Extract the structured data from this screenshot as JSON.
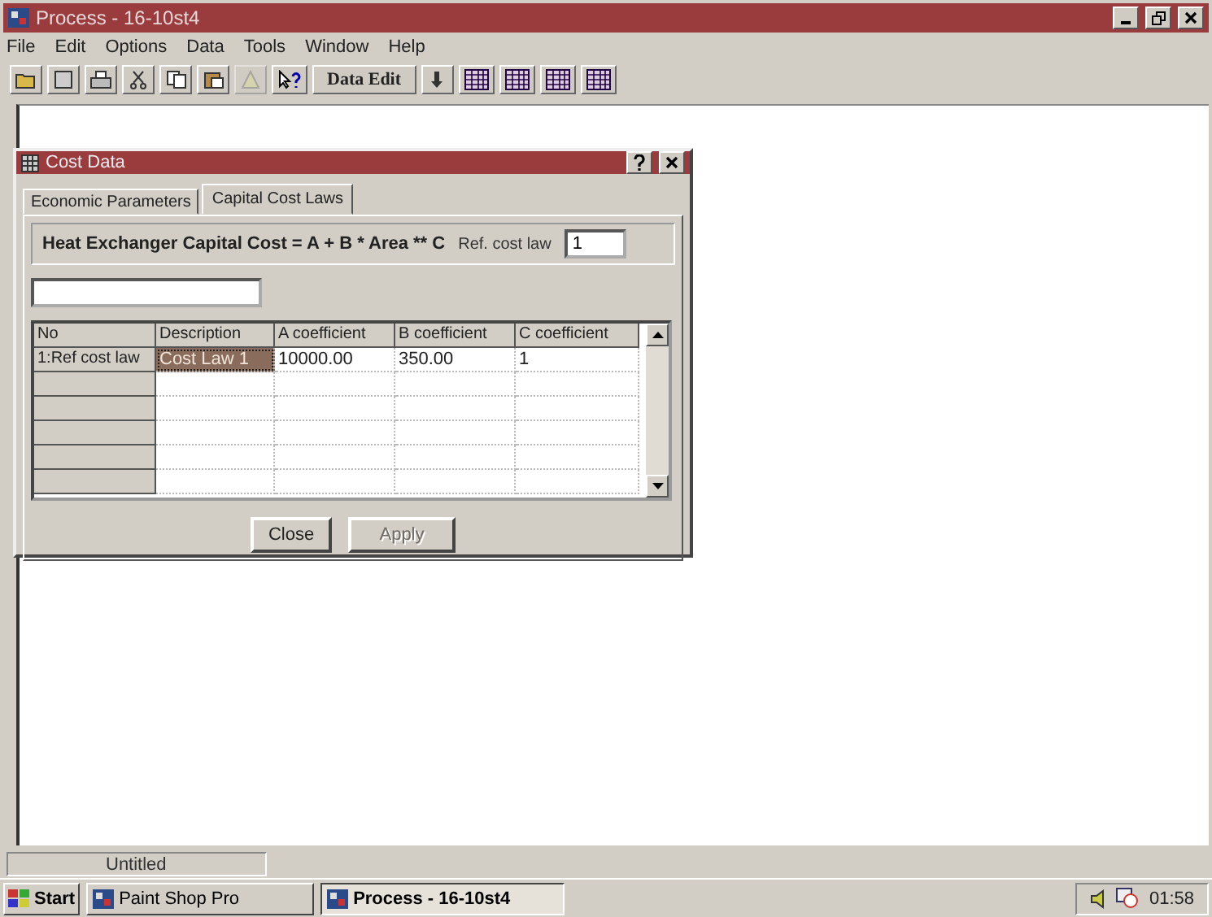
{
  "window": {
    "title": "Process - 16-10st4"
  },
  "menu": [
    "File",
    "Edit",
    "Options",
    "Data",
    "Tools",
    "Window",
    "Help"
  ],
  "toolbar": [
    {
      "kind": "open",
      "disabled": false
    },
    {
      "kind": "save",
      "disabled": false
    },
    {
      "kind": "print",
      "disabled": false
    },
    {
      "kind": "cut",
      "disabled": false
    },
    {
      "kind": "copy",
      "disabled": false
    },
    {
      "kind": "paste",
      "disabled": false
    },
    {
      "kind": "warning",
      "disabled": true
    },
    {
      "kind": "help",
      "disabled": false
    },
    {
      "kind": "text",
      "label": "Data Edit",
      "disabled": false
    },
    {
      "kind": "down",
      "disabled": false
    },
    {
      "kind": "grid",
      "disabled": false
    },
    {
      "kind": "grid",
      "disabled": false
    },
    {
      "kind": "grid",
      "disabled": false
    },
    {
      "kind": "grid",
      "disabled": false
    }
  ],
  "dialog": {
    "title": "Cost Data",
    "tabs": [
      {
        "label": "Economic Parameters",
        "selected": false
      },
      {
        "label": "Capital Cost Laws",
        "selected": true
      }
    ],
    "formula": "Heat Exchanger Capital Cost = A + B * Area ** C",
    "ref_label": "Ref. cost law",
    "ref_value": "1",
    "table": {
      "columns": [
        "No",
        "Description",
        "A coefficient",
        "B coefficient",
        "C coefficient"
      ],
      "rows": [
        {
          "cells": [
            {
              "text": "1:Ref cost law",
              "selected": false
            },
            {
              "text": "Cost Law 1",
              "selected": true
            },
            {
              "text": "10000.00",
              "selected": false
            },
            {
              "text": "350.00",
              "selected": false
            },
            {
              "text": "1",
              "selected": false
            }
          ]
        }
      ]
    },
    "buttons": [
      {
        "label": "Close",
        "disabled": false
      },
      {
        "label": "Apply",
        "disabled": true
      }
    ]
  },
  "status_bar": "Untitled",
  "taskbar": {
    "start": "Start",
    "tasks": [
      {
        "label": "Paint Shop Pro",
        "selected": false
      },
      {
        "label": "Process - 16-10st4",
        "selected": true
      }
    ],
    "clock": "01:58"
  }
}
